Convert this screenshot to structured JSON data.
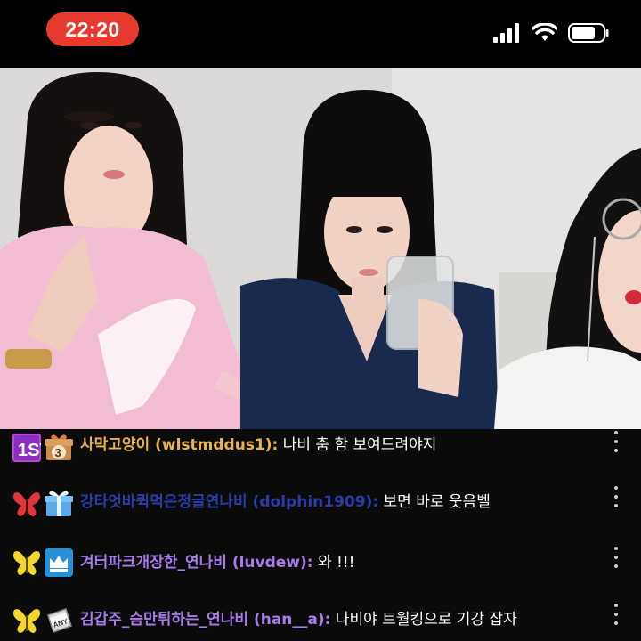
{
  "status_bar": {
    "time": "22:20",
    "icons": [
      "signal-icon",
      "wifi-icon",
      "battery-icon"
    ]
  },
  "video": {
    "description_icons": [
      "live-video-feed"
    ]
  },
  "chat": {
    "messages": [
      {
        "rank_badge": "1ST",
        "gift_badge_number": "3",
        "username": "사막고양이 (wlstmddus1):",
        "username_color": "#e9b34a",
        "text": "나비 춤 함 보여드려야지"
      },
      {
        "rank_badge_icon": "red-butterfly-icon",
        "gift_badge_icon": "gift-box-icon",
        "username": "강타엇바퀵먹은정글연나비 (dolphin1909):",
        "username_color": "#2a3ca8",
        "text": "보면 바로 웃음벨"
      },
      {
        "rank_badge_icon": "yellow-butterfly-icon",
        "gift_badge_icon": "crown-icon",
        "username": "겨터파크개장한_연나비 (luvdew):",
        "username_color": "#a77be8",
        "text": "와 !!!"
      },
      {
        "rank_badge_icon": "yellow-butterfly-icon",
        "gift_badge_label": "ANY",
        "username": "김갑주_슴만튀하는_연나비 (han__a):",
        "username_color": "#a77be8",
        "text": "나비야 트월킹으로 기강 잡자"
      }
    ]
  }
}
